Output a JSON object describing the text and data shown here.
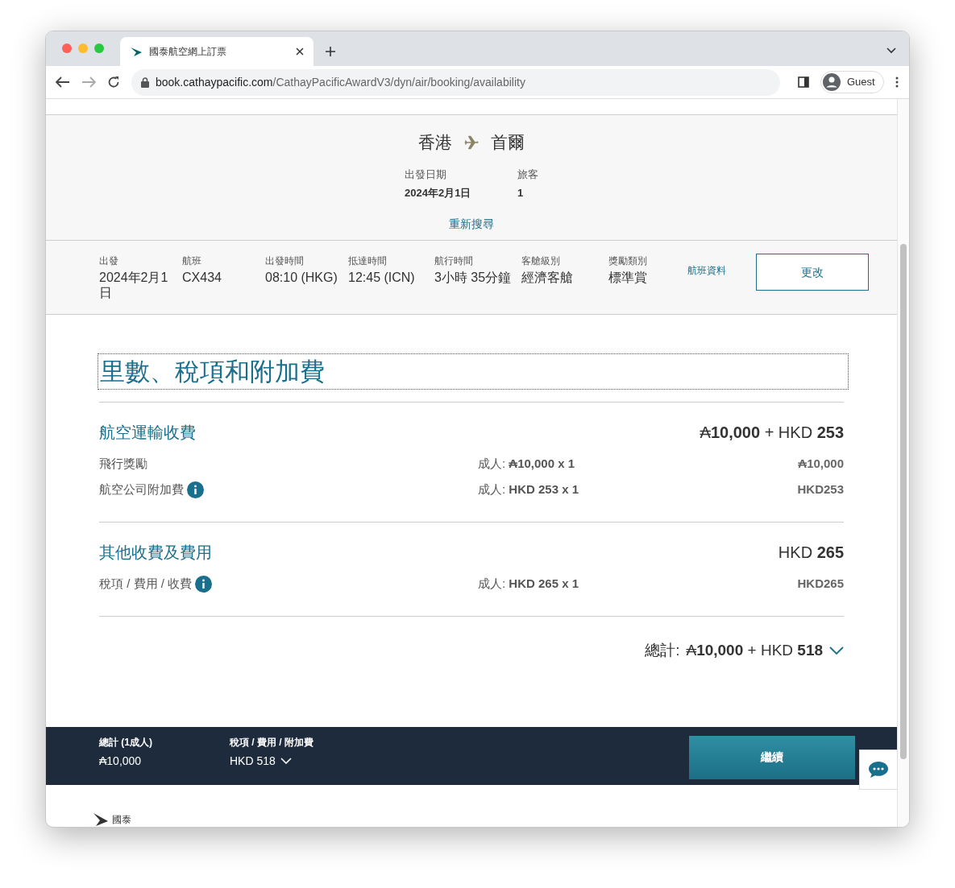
{
  "browser": {
    "tab_title": "國泰航空網上訂票",
    "url_host": "book.cathaypacific.com",
    "url_path": "/CathayPacificAwardV3/dyn/air/booking/availability",
    "profile": "Guest"
  },
  "route": {
    "origin": "香港",
    "destination": "首爾"
  },
  "trip_info": [
    {
      "label": "出發日期",
      "value": "2024年2月1日"
    },
    {
      "label": "旅客",
      "value": "1"
    }
  ],
  "new_search_link": "重新搜尋",
  "flight": {
    "fields": [
      {
        "label": "出發",
        "value": "2024年2月1日"
      },
      {
        "label": "航班",
        "value": "CX434"
      },
      {
        "label": "出發時間",
        "value": "08:10 (HKG)"
      },
      {
        "label": "抵達時間",
        "value": "12:45 (ICN)"
      },
      {
        "label": "航行時間",
        "value": "3小時 35分鐘"
      },
      {
        "label": "客艙級別",
        "value": "經濟客艙"
      },
      {
        "label": "獎勵類別",
        "value": "標準賞"
      }
    ],
    "details_link": "航班資料",
    "change_button": "更改"
  },
  "heading": "里數、稅項和附加費",
  "sections": [
    {
      "title": "航空運輸收費",
      "total": "₳**10,000** + HKD **253**",
      "items": [
        {
          "label": "飛行獎勵",
          "info": false,
          "unit": "成人: **₳10,000 x 1**",
          "amount": "₳10,000"
        },
        {
          "label": "航空公司附加費",
          "info": true,
          "unit": "成人: **HKD 253 x 1**",
          "amount": "HKD253"
        }
      ]
    },
    {
      "title": "其他收費及費用",
      "total": "HKD **265**",
      "items": [
        {
          "label": "稅項 / 費用 / 收費",
          "info": true,
          "unit": "成人: **HKD 265 x 1**",
          "amount": "HKD265"
        }
      ]
    }
  ],
  "grand_total": {
    "label": "總計:",
    "value": "₳**10,000** + HKD **518**"
  },
  "footer_bar": {
    "total_label": "總計 (1成人)",
    "total_value": "₳10,000",
    "tax_label": "稅項 / 費用 / 附加費",
    "tax_value": "HKD 518",
    "continue_button": "繼續"
  },
  "brand_text": "國泰"
}
